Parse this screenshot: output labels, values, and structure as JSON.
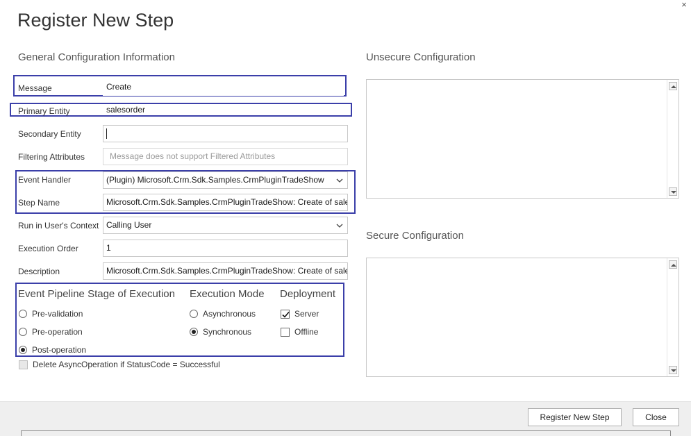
{
  "dialog": {
    "title": "Register New Step",
    "close_glyph": "×"
  },
  "general": {
    "title": "General Configuration Information",
    "message": {
      "label": "Message",
      "value": "Create"
    },
    "primary_entity": {
      "label": "Primary Entity",
      "value": "salesorder"
    },
    "secondary_entity": {
      "label": "Secondary Entity",
      "value": ""
    },
    "filtering_attributes": {
      "label": "Filtering Attributes",
      "placeholder": "Message does not support Filtered Attributes"
    },
    "event_handler": {
      "label": "Event Handler",
      "value": "(Plugin) Microsoft.Crm.Sdk.Samples.CrmPluginTradeShow"
    },
    "step_name": {
      "label": "Step Name",
      "value": "Microsoft.Crm.Sdk.Samples.CrmPluginTradeShow: Create of salesorder"
    },
    "run_context": {
      "label": "Run in User's Context",
      "value": "Calling User"
    },
    "execution_order": {
      "label": "Execution Order",
      "value": "1"
    },
    "description": {
      "label": "Description",
      "value": "Microsoft.Crm.Sdk.Samples.CrmPluginTradeShow: Create of salesorder"
    }
  },
  "pipeline": {
    "title": "Event Pipeline Stage of Execution",
    "options": [
      {
        "label": "Pre-validation",
        "selected": false
      },
      {
        "label": "Pre-operation",
        "selected": false
      },
      {
        "label": "Post-operation",
        "selected": true
      }
    ]
  },
  "execution_mode": {
    "title": "Execution Mode",
    "options": [
      {
        "label": "Asynchronous",
        "selected": false
      },
      {
        "label": "Synchronous",
        "selected": true
      }
    ]
  },
  "deployment": {
    "title": "Deployment",
    "options": [
      {
        "label": "Server",
        "checked": true
      },
      {
        "label": "Offline",
        "checked": false
      }
    ]
  },
  "delete_async": {
    "label": "Delete AsyncOperation if StatusCode = Successful",
    "checked": false
  },
  "unsecure": {
    "title": "Unsecure  Configuration"
  },
  "secure": {
    "title": "Secure  Configuration"
  },
  "footer": {
    "register_label": "Register New Step",
    "close_label": "Close"
  },
  "colors": {
    "highlight_border": "#3b3fa9",
    "footer_bg": "#efefef",
    "input_border": "#c8c8c8"
  }
}
